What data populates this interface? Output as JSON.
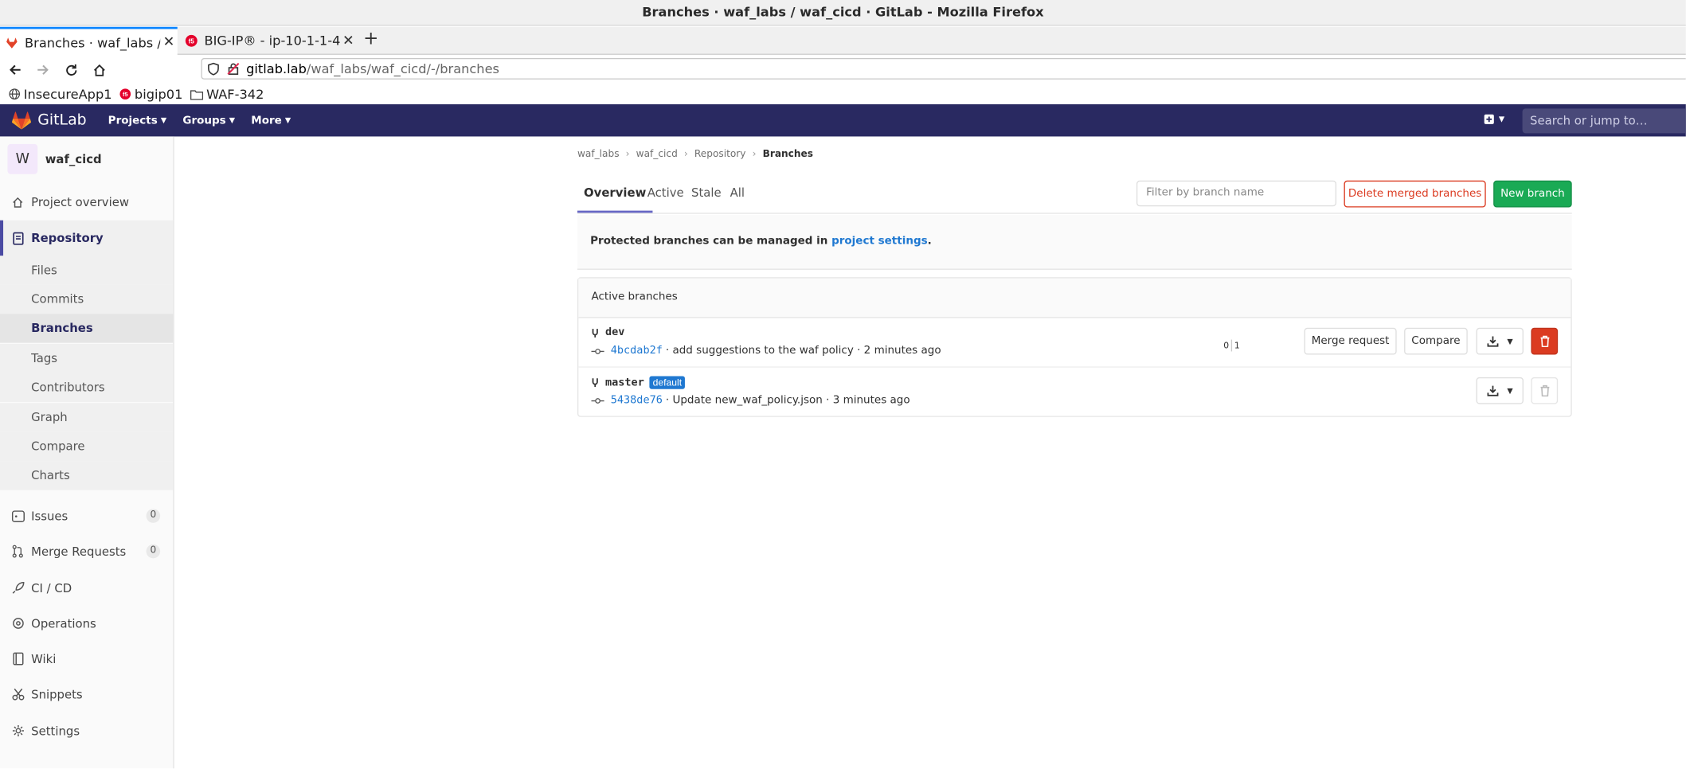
{
  "browser": {
    "window_title": "Branches · waf_labs / waf_cicd · GitLab - Mozilla Firefox",
    "tabs": [
      {
        "title": "Branches · waf_labs / w",
        "active": true
      },
      {
        "title": "BIG-IP® - ip-10-1-1-4",
        "active": false
      }
    ],
    "url_host": "gitlab.lab",
    "url_path": "/waf_labs/waf_cicd/-/branches",
    "bookmarks": [
      "InsecureApp1",
      "bigip01",
      "WAF-342"
    ]
  },
  "header": {
    "brand": "GitLab",
    "nav": [
      "Projects",
      "Groups",
      "More"
    ],
    "search_placeholder": "Search or jump to…"
  },
  "sidebar": {
    "project_initial": "W",
    "project_name": "waf_cicd",
    "items": {
      "overview": "Project overview",
      "repository": "Repository",
      "issues": "Issues",
      "issues_count": "0",
      "merge_requests": "Merge Requests",
      "merge_requests_count": "0",
      "cicd": "CI / CD",
      "operations": "Operations",
      "wiki": "Wiki",
      "snippets": "Snippets",
      "settings": "Settings"
    },
    "repo_sub": [
      "Files",
      "Commits",
      "Branches",
      "Tags",
      "Contributors",
      "Graph",
      "Compare",
      "Charts"
    ]
  },
  "breadcrumb": [
    "waf_labs",
    "waf_cicd",
    "Repository",
    "Branches"
  ],
  "tabs": [
    "Overview",
    "Active",
    "Stale",
    "All"
  ],
  "filter_placeholder": "Filter by branch name",
  "buttons": {
    "delete_merged": "Delete merged branches",
    "new_branch": "New branch",
    "merge_request": "Merge request",
    "compare": "Compare"
  },
  "notice": {
    "text": "Protected branches can be managed in ",
    "link": "project settings",
    "end": "."
  },
  "panel_title": "Active branches",
  "branches": [
    {
      "name": "dev",
      "sha": "4bcdab2f",
      "message": "· add suggestions to the waf policy · 2 minutes ago",
      "behind": "0",
      "ahead": "1",
      "is_default": false
    },
    {
      "name": "master",
      "sha": "5438de76",
      "message": "· Update new_waf_policy.json · 3 minutes ago",
      "badge": "default",
      "is_default": true
    }
  ],
  "colors": {
    "header": "#292961",
    "primary_link": "#1f78d1",
    "success": "#1aaa55",
    "danger": "#db3b21"
  }
}
